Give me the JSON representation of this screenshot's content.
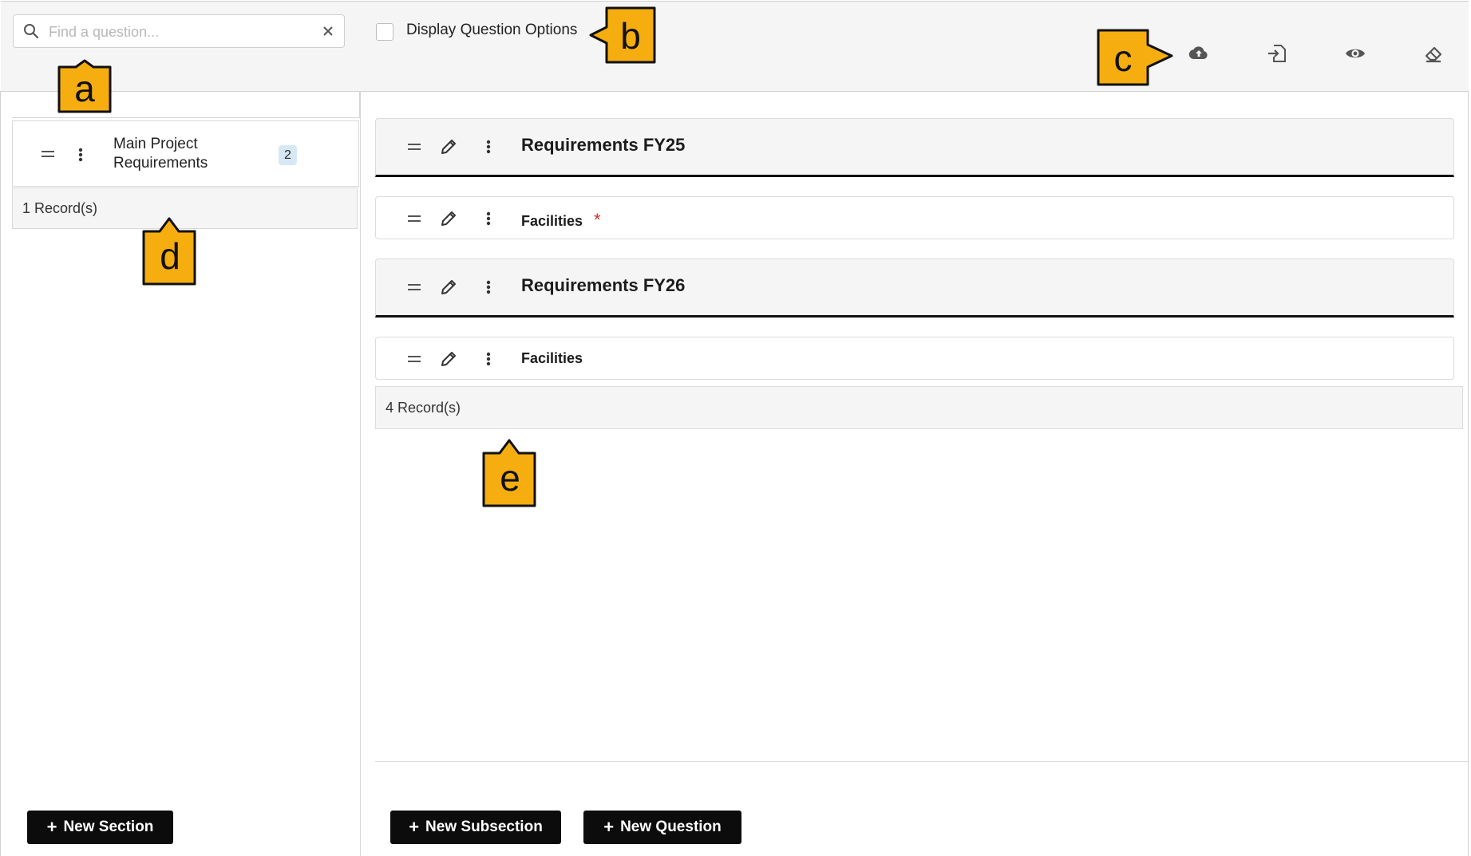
{
  "toolbar": {
    "search_placeholder": "Find a question...",
    "display_options_label": "Display Question Options",
    "icons": [
      "cloud-upload-icon",
      "import-icon",
      "preview-eye-icon",
      "eraser-icon"
    ]
  },
  "left_panel": {
    "sections": [
      {
        "label": "Main Project Requirements",
        "count": "2"
      }
    ],
    "records": "1 Record(s)",
    "new_section_label": "New Section"
  },
  "right_panel": {
    "rows": [
      {
        "type": "subsection",
        "label": "Requirements FY25"
      },
      {
        "type": "question",
        "label": "Facilities",
        "required": true,
        "required_mark": "*"
      },
      {
        "type": "subsection",
        "label": "Requirements FY26"
      },
      {
        "type": "question",
        "label": "Facilities",
        "required": false
      }
    ],
    "records": "4 Record(s)",
    "new_subsection_label": "New Subsection",
    "new_question_label": "New Question"
  },
  "callouts": {
    "a": "a",
    "b": "b",
    "c": "c",
    "d": "d",
    "e": "e",
    "fill_color": "#f5ad0f",
    "stroke_color": "#111111"
  }
}
